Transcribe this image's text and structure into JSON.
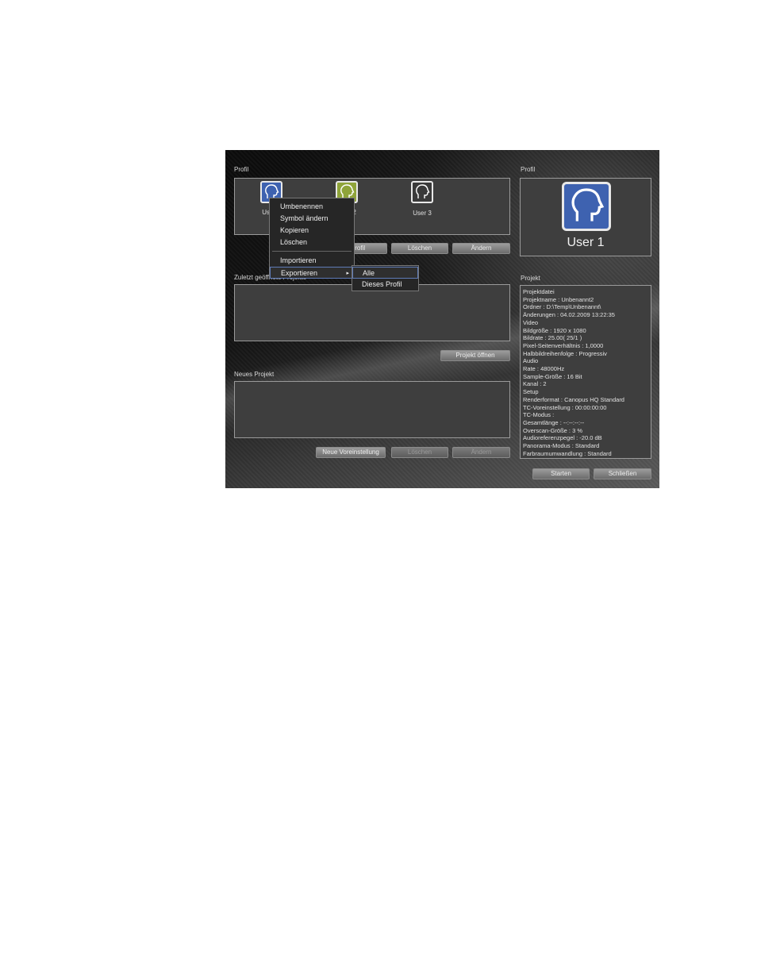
{
  "left": {
    "profile_label": "Profil",
    "users": [
      {
        "label": "User 1"
      },
      {
        "label": "User 2"
      },
      {
        "label": "User 3"
      }
    ],
    "buttons": {
      "new_profile": "Profil",
      "delete": "Löschen",
      "change": "Ändern"
    },
    "recent_label": "Zuletzt geöffnete Projekte",
    "open_project": "Projekt öffnen",
    "new_project_label": "Neues Projekt",
    "new_preset": "Neue Voreinstellung",
    "delete_preset": "Löschen",
    "change_preset": "Ändern"
  },
  "right": {
    "profile_label": "Profil",
    "current_user": "User 1",
    "project_label": "Projekt",
    "info_lines": [
      "Projektdatei",
      "  Projektname : Unbenannt2",
      "  Ordner : D:\\Temp\\Unbenannt\\",
      "  Änderungen : 04.02.2009 13:22:35",
      "Video",
      "Bildgröße : 1920 x 1080",
      "Bildrate : 25.00( 25/1 )",
      "Pixel-Seitenverhältnis : 1,0000",
      "Halbbildreihenfolge : Progressiv",
      "Audio",
      "Rate : 48000Hz",
      "Sample-Größe : 16 Bit",
      "Kanal : 2",
      "Setup",
      "Renderformat : Canopus HQ Standard",
      "TC-Voreinstellung : 00:00:00:00",
      "TC-Modus :",
      "Gesamtlänge : --:--:--:--",
      "Overscan-Größe : 3 %",
      "Audioreferenzpegel : -20.0 dB",
      "Panorama-Modus : Standard",
      "Farbraumumwandlung : Standard"
    ],
    "start": "Starten",
    "close": "Schließen"
  },
  "context_menu": {
    "items": [
      "Umbenennen",
      "Symbol ändern",
      "Kopieren",
      "Löschen",
      "Importieren",
      "Exportieren"
    ],
    "submenu": [
      "Alle",
      "Dieses Profil"
    ]
  },
  "colors": {
    "user1": "#3e62b0",
    "user2": "#8fa43a",
    "user3": "#3a3a3a",
    "accent": "#5f7bb8"
  }
}
